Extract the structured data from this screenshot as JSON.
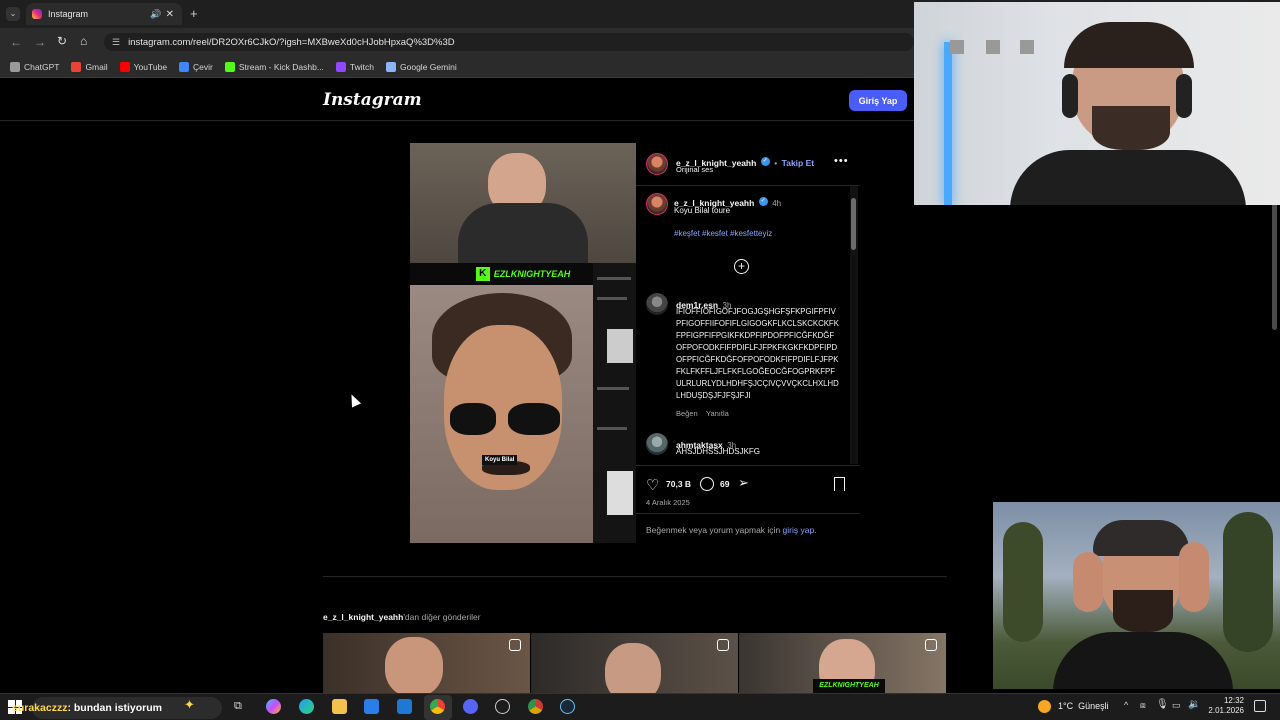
{
  "browser": {
    "tab_title": "Instagram",
    "url": "instagram.com/reel/DR2OXr6CJkO/?igsh=MXBweXd0cHJobHpxaQ%3D%3D",
    "bookmarks": [
      {
        "label": "ChatGPT",
        "icon": "chatgpt-icon",
        "color": "#9a9a9a"
      },
      {
        "label": "Gmail",
        "icon": "gmail-icon",
        "color": "#ea4335"
      },
      {
        "label": "YouTube",
        "icon": "youtube-icon",
        "color": "#ff0000"
      },
      {
        "label": "Çevir",
        "icon": "translate-icon",
        "color": "#4285f4"
      },
      {
        "label": "Stream - Kick Dashb...",
        "icon": "kick-icon",
        "color": "#53fc18"
      },
      {
        "label": "Twitch",
        "icon": "twitch-icon",
        "color": "#9146ff"
      },
      {
        "label": "Google Gemini",
        "icon": "gemini-icon",
        "color": "#8ab4f8"
      }
    ]
  },
  "instagram": {
    "logo": "Instagram",
    "login_button": "Giriş Yap",
    "post": {
      "author": "e_z_l_knight_yeahh",
      "follow": "Takip Et",
      "audio": "Orijinal ses",
      "caption_time": "4h",
      "caption": "Koyu Bilal toure",
      "hashtags": "#keşfet #kesfet #kesfetteyiz",
      "video_overlay_brand": "EZLKNIGHTYEAH",
      "video_caption_sticker": "Koyu Bilal",
      "likes": "70,3 B",
      "comments_count": "69",
      "date": "4 Aralık 2025",
      "login_prompt": "Beğenmek veya yorum yapmak için",
      "login_link": "giriş yap",
      "comments": [
        {
          "user": "dem1r.esn",
          "time": "3h",
          "text": "IFIOFFIOFIGOFJFOGJGŞHGFŞFKPGIFPFIVPFIGOFFIIFOFIFLGIGOGKFLKCLSKCKCKFKFPFIGPFIFPGIKFKDPFIPDOFPFICĞFKDĞFOFPOFODKFIFPDIFLFJFPKFKGKFKDPFIPDOFPFICĞFKDĞFOFPOFODKFIFPDIFLFJFPKFKLFKFFLJFLFKFLGOĞEOCĞFOGPRKFPFULRLURLYDLHDHFŞJCÇIVÇVVÇKCLHXLHDLHDUŞDŞJFJFŞJFJI",
          "like": "Beğen",
          "reply": "Yanıtla"
        },
        {
          "user": "ahmtaktasx",
          "time": "3h",
          "text": "AHSJDHSSJHDSJKFG"
        }
      ]
    },
    "more_posts_user": "e_z_l_knight_yeahh",
    "more_posts_suffix": "'dan diğer gönderiler"
  },
  "chat_overlay": {
    "user": "surakaczzz",
    "message": "bundan istiyorum"
  },
  "taskbar": {
    "weather": "1°C  Güneşli",
    "time": "12:32",
    "date": "2.01.2026"
  }
}
